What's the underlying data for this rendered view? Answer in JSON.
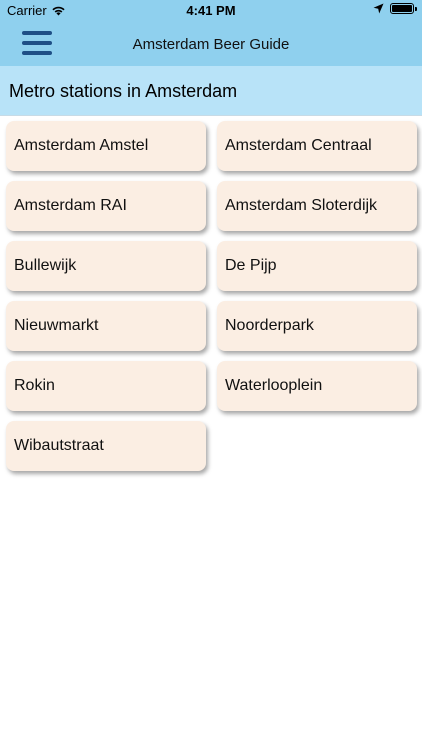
{
  "status_bar": {
    "carrier": "Carrier",
    "time": "4:41 PM"
  },
  "nav": {
    "title": "Amsterdam Beer Guide",
    "menu_icon": "hamburger-menu-icon"
  },
  "section": {
    "title": "Metro stations in Amsterdam"
  },
  "stations": [
    {
      "label": "Amsterdam Amstel"
    },
    {
      "label": "Amsterdam Centraal"
    },
    {
      "label": "Amsterdam RAI"
    },
    {
      "label": "Amsterdam Sloterdijk"
    },
    {
      "label": "Bullewijk"
    },
    {
      "label": "De Pijp"
    },
    {
      "label": "Nieuwmarkt"
    },
    {
      "label": "Noorderpark"
    },
    {
      "label": "Rokin"
    },
    {
      "label": "Waterlooplein"
    },
    {
      "label": "Wibautstraat"
    }
  ],
  "colors": {
    "nav_background": "#8fd0ee",
    "section_background": "#b8e3f8",
    "card_background": "#fbeee3",
    "menu_icon": "#1e4f86"
  }
}
